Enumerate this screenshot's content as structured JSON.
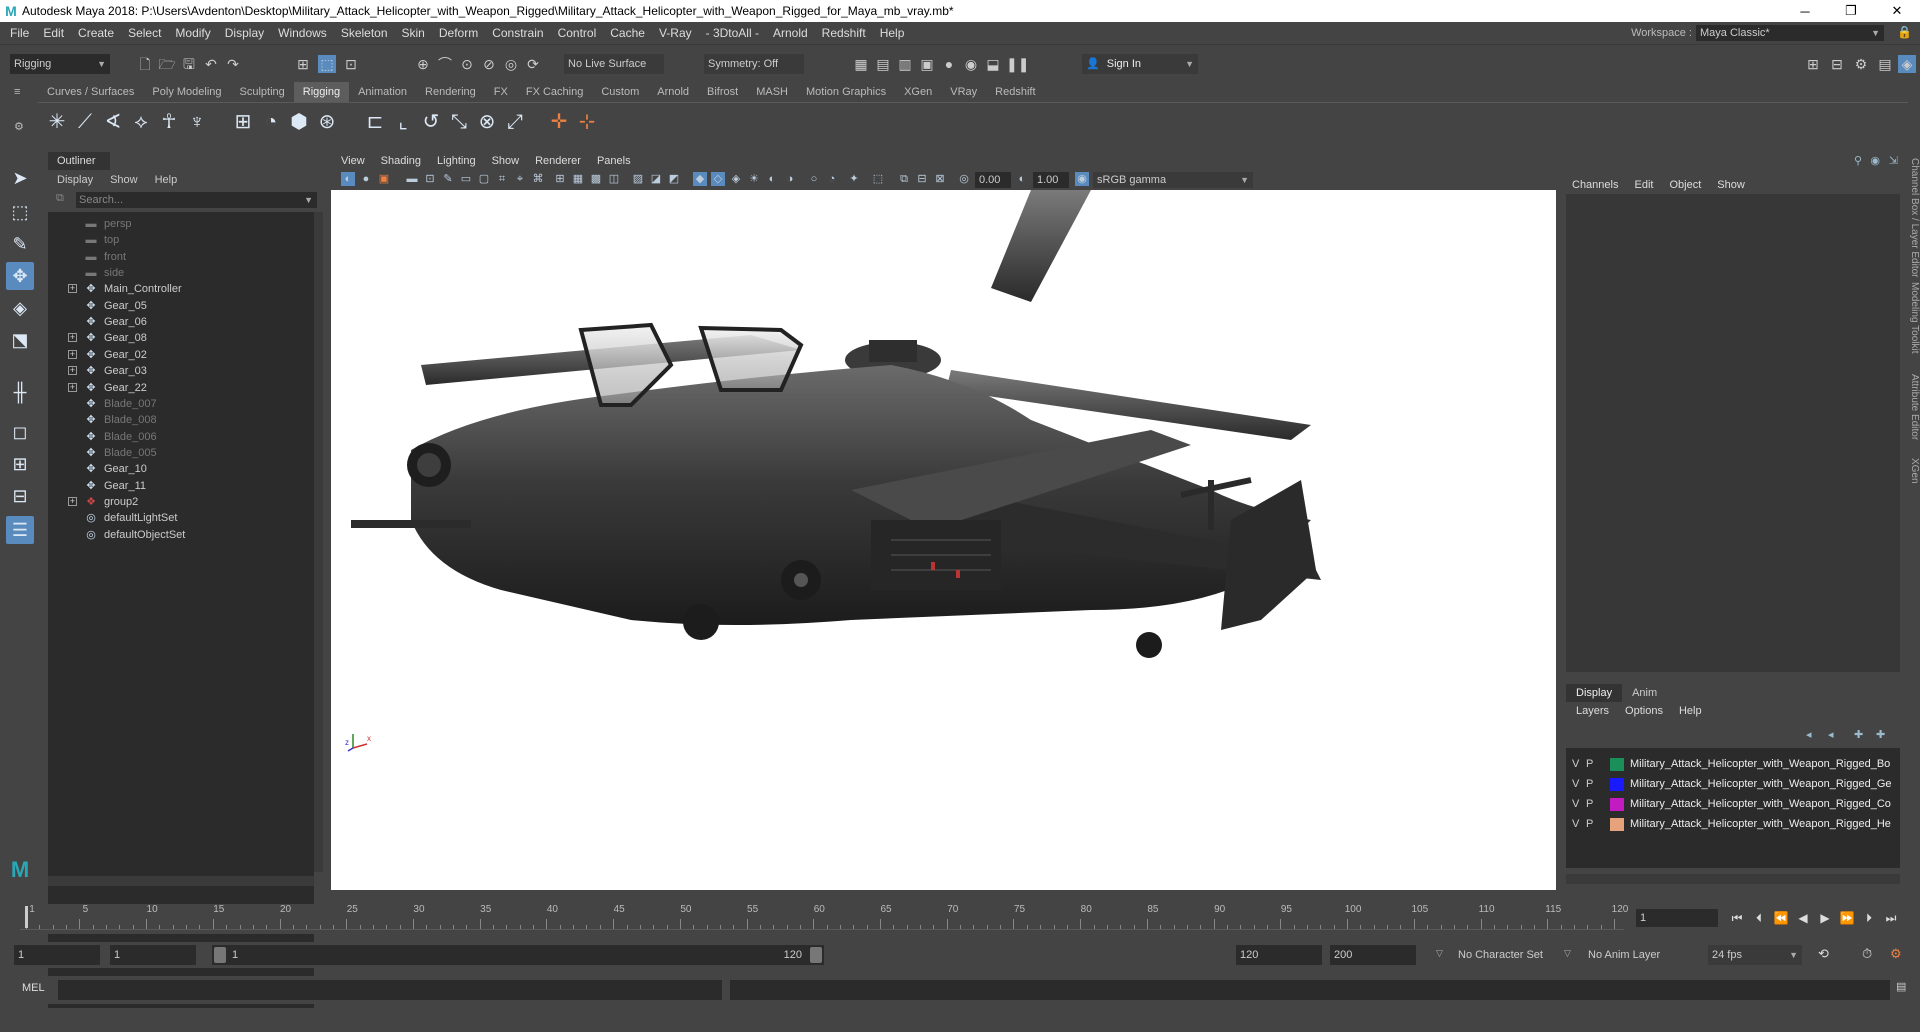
{
  "window": {
    "title": "Autodesk Maya 2018: P:\\Users\\Avdenton\\Desktop\\Military_Attack_Helicopter_with_Weapon_Rigged\\Military_Attack_Helicopter_with_Weapon_Rigged_for_Maya_mb_vray.mb*",
    "logo": "M",
    "minimize": "─",
    "maximize": "❐",
    "close": "✕"
  },
  "menubar": {
    "items": [
      "File",
      "Edit",
      "Create",
      "Select",
      "Modify",
      "Display",
      "Windows",
      "Skeleton",
      "Skin",
      "Deform",
      "Constrain",
      "Control",
      "Cache",
      "V-Ray",
      "- 3DtoAll -",
      "Arnold",
      "Redshift",
      "Help"
    ],
    "workspace_label": "Workspace :",
    "workspace_value": "Maya Classic*"
  },
  "statusline": {
    "menuset": "Rigging",
    "live_surface": "No Live Surface",
    "symmetry": "Symmetry: Off",
    "sign_in": "Sign In"
  },
  "shelf": {
    "tabs": [
      "Curves / Surfaces",
      "Poly Modeling",
      "Sculpting",
      "Rigging",
      "Animation",
      "Rendering",
      "FX",
      "FX Caching",
      "Custom",
      "Arnold",
      "Bifrost",
      "MASH",
      "Motion Graphics",
      "XGen",
      "VRay",
      "Redshift"
    ],
    "active_tab": "Rigging"
  },
  "outliner": {
    "tab": "Outliner",
    "menu": [
      "Display",
      "Show",
      "Help"
    ],
    "search_placeholder": "Search...",
    "items": [
      {
        "label": "persp",
        "type": "camera",
        "expandable": false,
        "dim": true
      },
      {
        "label": "top",
        "type": "camera",
        "expandable": false,
        "dim": true
      },
      {
        "label": "front",
        "type": "camera",
        "expandable": false,
        "dim": true
      },
      {
        "label": "side",
        "type": "camera",
        "expandable": false,
        "dim": true
      },
      {
        "label": "Main_Controller",
        "type": "transform",
        "expandable": true,
        "dim": false
      },
      {
        "label": "Gear_05",
        "type": "transform",
        "expandable": false,
        "dim": false
      },
      {
        "label": "Gear_06",
        "type": "transform",
        "expandable": false,
        "dim": false
      },
      {
        "label": "Gear_08",
        "type": "transform",
        "expandable": true,
        "dim": false
      },
      {
        "label": "Gear_02",
        "type": "transform",
        "expandable": true,
        "dim": false
      },
      {
        "label": "Gear_03",
        "type": "transform",
        "expandable": true,
        "dim": false
      },
      {
        "label": "Gear_22",
        "type": "transform",
        "expandable": true,
        "dim": false
      },
      {
        "label": "Blade_007",
        "type": "transform",
        "expandable": false,
        "dim": true
      },
      {
        "label": "Blade_008",
        "type": "transform",
        "expandable": false,
        "dim": true
      },
      {
        "label": "Blade_006",
        "type": "transform",
        "expandable": false,
        "dim": true
      },
      {
        "label": "Blade_005",
        "type": "transform",
        "expandable": false,
        "dim": true
      },
      {
        "label": "Gear_10",
        "type": "transform",
        "expandable": false,
        "dim": false
      },
      {
        "label": "Gear_11",
        "type": "transform",
        "expandable": false,
        "dim": false
      },
      {
        "label": "group2",
        "type": "group",
        "expandable": true,
        "dim": false
      },
      {
        "label": "defaultLightSet",
        "type": "set",
        "expandable": false,
        "dim": false
      },
      {
        "label": "defaultObjectSet",
        "type": "set",
        "expandable": false,
        "dim": false
      }
    ]
  },
  "viewport": {
    "menu": [
      "View",
      "Shading",
      "Lighting",
      "Show",
      "Renderer",
      "Panels"
    ],
    "exposure": "0.00",
    "gamma": "1.00",
    "color_space": "sRGB gamma",
    "axis_x": "x",
    "axis_z": "z"
  },
  "channelbox": {
    "menu": [
      "Channels",
      "Edit",
      "Object",
      "Show"
    ]
  },
  "layers": {
    "tabs": [
      "Display",
      "Anim"
    ],
    "active_tab": "Display",
    "menu": [
      "Layers",
      "Options",
      "Help"
    ],
    "items": [
      {
        "v": "V",
        "p": "P",
        "color": "#1b8f5a",
        "name": "Military_Attack_Helicopter_with_Weapon_Rigged_Bo"
      },
      {
        "v": "V",
        "p": "P",
        "color": "#1a1aff",
        "name": "Military_Attack_Helicopter_with_Weapon_Rigged_Ge"
      },
      {
        "v": "V",
        "p": "P",
        "color": "#c21bc2",
        "name": "Military_Attack_Helicopter_with_Weapon_Rigged_Co"
      },
      {
        "v": "V",
        "p": "P",
        "color": "#e6a27a",
        "name": "Military_Attack_Helicopter_with_Weapon_Rigged_He"
      }
    ]
  },
  "side_tabs": [
    "Channel Box / Layer Editor",
    "Modeling Toolkit",
    "Attribute Editor",
    "XGen"
  ],
  "timeslider": {
    "ticks": [
      "1",
      "5",
      "10",
      "15",
      "20",
      "25",
      "30",
      "35",
      "40",
      "45",
      "50",
      "55",
      "60",
      "65",
      "70",
      "75",
      "80",
      "85",
      "90",
      "95",
      "100",
      "105",
      "110",
      "115",
      "120"
    ],
    "current_frame": "1"
  },
  "rangeslider": {
    "start": "1",
    "anim_start": "1",
    "range_start": "1",
    "range_end": "120",
    "playback_end": "120",
    "anim_end": "200",
    "character_set": "No Character Set",
    "anim_layer": "No Anim Layer",
    "fps": "24 fps"
  },
  "cmdline": {
    "label": "MEL"
  }
}
